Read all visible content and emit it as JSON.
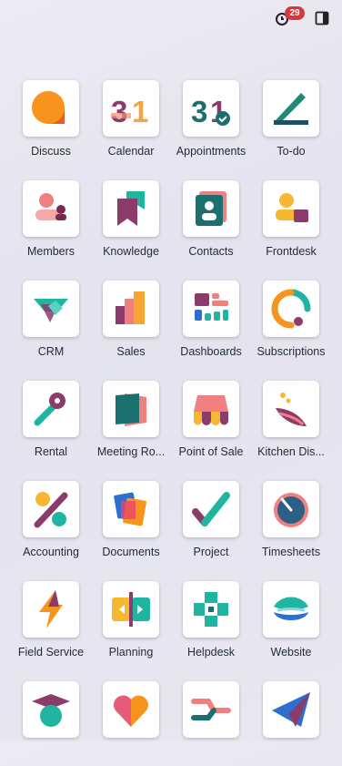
{
  "systray": {
    "activity_count": "29"
  },
  "apps": [
    {
      "label": "Discuss",
      "icon": "discuss-icon"
    },
    {
      "label": "Calendar",
      "icon": "calendar-icon"
    },
    {
      "label": "Appointments",
      "icon": "appointments-icon"
    },
    {
      "label": "To-do",
      "icon": "todo-icon"
    },
    {
      "label": "Members",
      "icon": "members-icon"
    },
    {
      "label": "Knowledge",
      "icon": "knowledge-icon"
    },
    {
      "label": "Contacts",
      "icon": "contacts-icon"
    },
    {
      "label": "Frontdesk",
      "icon": "frontdesk-icon"
    },
    {
      "label": "CRM",
      "icon": "crm-icon"
    },
    {
      "label": "Sales",
      "icon": "sales-icon"
    },
    {
      "label": "Dashboards",
      "icon": "dashboards-icon"
    },
    {
      "label": "Subscriptions",
      "icon": "subscriptions-icon"
    },
    {
      "label": "Rental",
      "icon": "rental-icon"
    },
    {
      "label": "Meeting Ro...",
      "icon": "meeting-rooms-icon"
    },
    {
      "label": "Point of Sale",
      "icon": "point-of-sale-icon"
    },
    {
      "label": "Kitchen Dis...",
      "icon": "kitchen-display-icon"
    },
    {
      "label": "Accounting",
      "icon": "accounting-icon"
    },
    {
      "label": "Documents",
      "icon": "documents-icon"
    },
    {
      "label": "Project",
      "icon": "project-icon"
    },
    {
      "label": "Timesheets",
      "icon": "timesheets-icon"
    },
    {
      "label": "Field Service",
      "icon": "field-service-icon"
    },
    {
      "label": "Planning",
      "icon": "planning-icon"
    },
    {
      "label": "Helpdesk",
      "icon": "helpdesk-icon"
    },
    {
      "label": "Website",
      "icon": "website-icon"
    },
    {
      "label": "",
      "icon": "elearning-icon"
    },
    {
      "label": "",
      "icon": "social-icon"
    },
    {
      "label": "",
      "icon": "inventory-flow-icon"
    },
    {
      "label": "",
      "icon": "email-marketing-icon"
    }
  ]
}
